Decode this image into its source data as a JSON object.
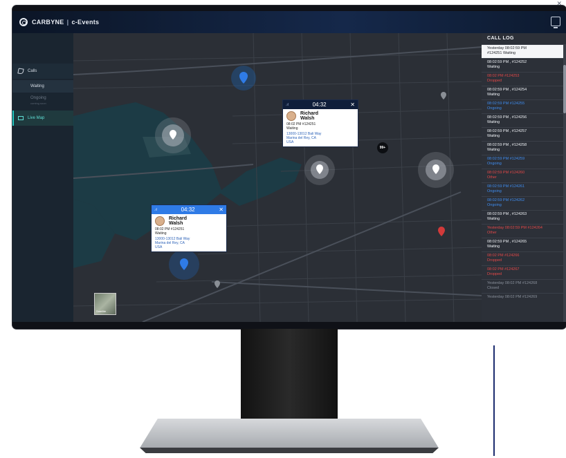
{
  "app": {
    "brand": "CARBYNE",
    "product": "c-Events"
  },
  "sidebar": {
    "calls_label": "Calls",
    "waiting_label": "Waiting",
    "ongoing_label": "Ongoing",
    "ongoing_sub": "coming soon",
    "live_map_label": "Live Map"
  },
  "popups": [
    {
      "timer": "04:32",
      "first_name": "Richard",
      "last_name": "Walsh",
      "time_id": "08:02 PM #124251",
      "status": "Waiting",
      "addr1": "13000-13012 Bali Way",
      "addr2": "Marina del Rey, CA",
      "addr3": "USA"
    },
    {
      "timer": "04:32",
      "first_name": "Richard",
      "last_name": "Walsh",
      "time_id": "08:02 PM #124251",
      "status": "Waiting",
      "addr1": "13000-13012 Bali Way",
      "addr2": "Marina del Rey, CA",
      "addr3": "USA"
    }
  ],
  "map": {
    "cluster_count": "99+",
    "satellite_label": "Satellite",
    "zoom_in": "+",
    "zoom_mid": "+",
    "zoom_out": "−"
  },
  "call_log": {
    "title": "CALL LOG",
    "items": [
      {
        "line1": "Yesterday 08:02:59 PM",
        "line2": "#124251 Waiting",
        "color": "#1b1e24",
        "selected": true
      },
      {
        "line1": "08:02:59 PM , #124252",
        "line2": "Waiting",
        "color": "#eef1f5"
      },
      {
        "line1": "08:02 PM #124253",
        "line2": "Dropped",
        "color": "#e44848"
      },
      {
        "line1": "08:02:59 PM , #124254",
        "line2": "Waiting",
        "color": "#eef1f5"
      },
      {
        "line1": "08:02:59 PM #124255",
        "line2": "Ongoing",
        "color": "#3f8df0"
      },
      {
        "line1": "08:02:59 PM , #124256",
        "line2": "Waiting",
        "color": "#eef1f5"
      },
      {
        "line1": "08:02:59 PM , #124257",
        "line2": "Waiting",
        "color": "#eef1f5"
      },
      {
        "line1": "08:02:59 PM , #124258",
        "line2": "Waiting",
        "color": "#eef1f5"
      },
      {
        "line1": "08:02:59 PM #124259",
        "line2": "Ongoing",
        "color": "#3f8df0"
      },
      {
        "line1": "08:02:59 PM #124260",
        "line2": "Other",
        "color": "#e44848"
      },
      {
        "line1": "08:02:59 PM #124261",
        "line2": "Ongoing",
        "color": "#3f8df0"
      },
      {
        "line1": "08:02:59 PM #124262",
        "line2": "Ongoing",
        "color": "#3f8df0"
      },
      {
        "line1": "08:02:59 PM , #124263",
        "line2": "Waiting",
        "color": "#eef1f5"
      },
      {
        "line1": "Yesterday 08:02:59 PM #124264",
        "line2": "Other",
        "color": "#e44848"
      },
      {
        "line1": "08:02:59 PM , #124265",
        "line2": "Waiting",
        "color": "#eef1f5"
      },
      {
        "line1": "08:02 PM #124266",
        "line2": "Dropped",
        "color": "#e44848"
      },
      {
        "line1": "08:02 PM #124267",
        "line2": "Dropped",
        "color": "#e44848"
      },
      {
        "line1": "Yesterday 08:02 PM #124268",
        "line2": "Closed",
        "color": "#8a919c"
      },
      {
        "line1": "Yesterday 08:02 PM #124269",
        "line2": "",
        "color": "#8a919c"
      }
    ]
  }
}
